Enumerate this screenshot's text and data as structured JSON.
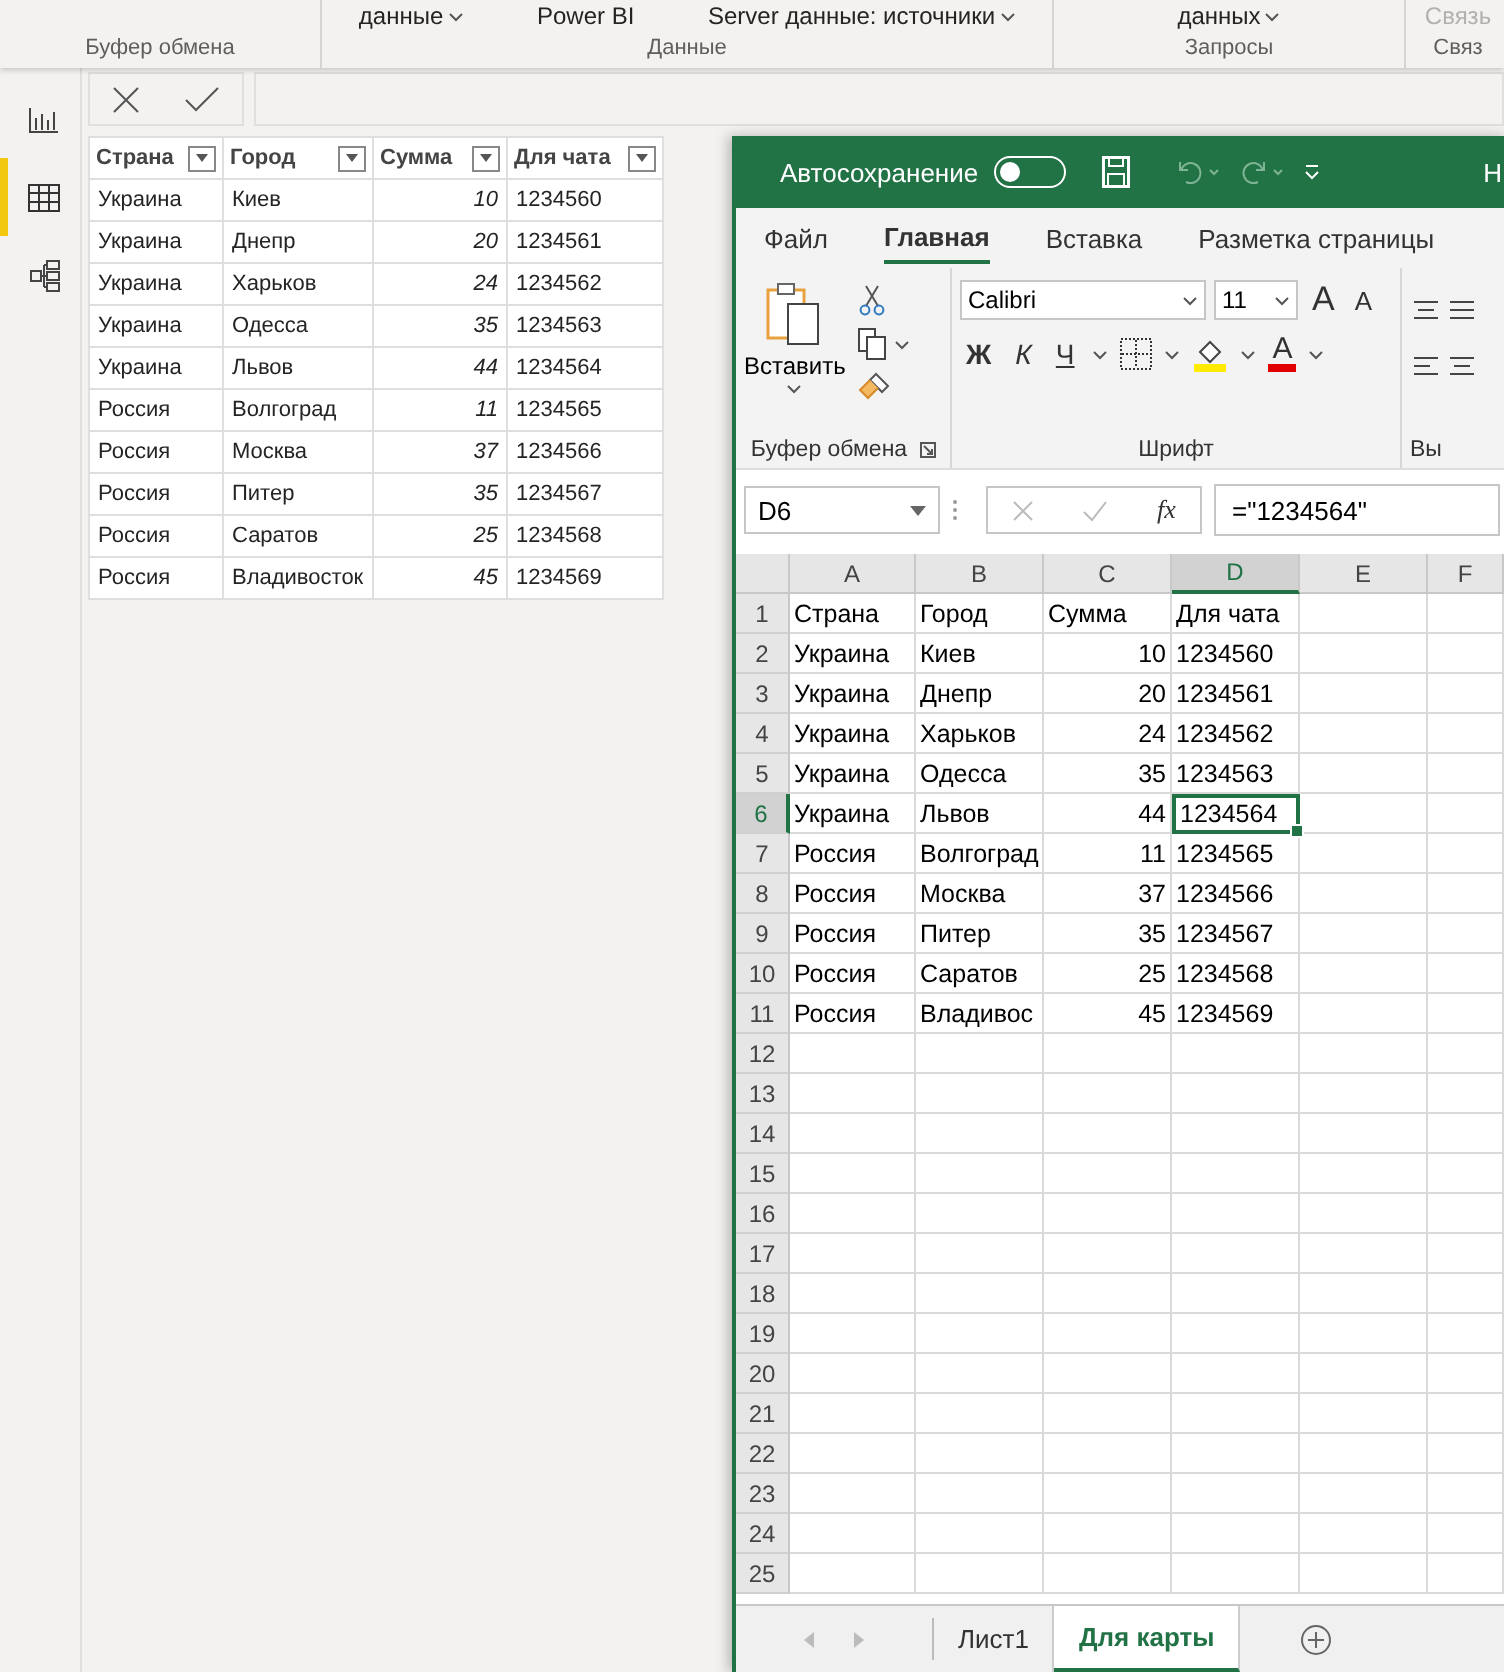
{
  "pbi": {
    "ribbon_groups": [
      {
        "label": "Буфер обмена"
      },
      {
        "label": "Данные",
        "commands": [
          {
            "label": "данные",
            "caret": true,
            "disabled": false
          },
          {
            "label": "Power BI",
            "caret": false,
            "disabled": false
          },
          {
            "label": "Server  данные: источники",
            "caret": true,
            "disabled": false
          }
        ]
      },
      {
        "label": "Запросы",
        "commands": [
          {
            "label": "данных",
            "caret": true,
            "disabled": false
          }
        ]
      },
      {
        "label": "Связ",
        "commands": [
          {
            "label": "Связь",
            "caret": false,
            "disabled": true
          }
        ]
      }
    ],
    "sidebar": {
      "items": [
        {
          "kind": "report",
          "selected": false
        },
        {
          "kind": "data",
          "selected": true
        },
        {
          "kind": "model",
          "selected": false
        }
      ]
    },
    "table": {
      "columns": [
        {
          "label": "Страна",
          "kind": "text"
        },
        {
          "label": "Город",
          "kind": "text"
        },
        {
          "label": "Сумма",
          "kind": "number"
        },
        {
          "label": "Для чата",
          "kind": "text"
        }
      ],
      "rows": [
        [
          "Украина",
          "Киев",
          "10",
          "1234560"
        ],
        [
          "Украина",
          "Днепр",
          "20",
          "1234561"
        ],
        [
          "Украина",
          "Харьков",
          "24",
          "1234562"
        ],
        [
          "Украина",
          "Одесса",
          "35",
          "1234563"
        ],
        [
          "Украина",
          "Львов",
          "44",
          "1234564"
        ],
        [
          "Россия",
          "Волгоград",
          "11",
          "1234565"
        ],
        [
          "Россия",
          "Москва",
          "37",
          "1234566"
        ],
        [
          "Россия",
          "Питер",
          "35",
          "1234567"
        ],
        [
          "Россия",
          "Саратов",
          "25",
          "1234568"
        ],
        [
          "Россия",
          "Владивосток",
          "45",
          "1234569"
        ]
      ]
    }
  },
  "excel": {
    "autosave": {
      "label": "Автосохранение",
      "on": false
    },
    "title": "Н",
    "tabs": [
      {
        "label": "Файл",
        "selected": false
      },
      {
        "label": "Главная",
        "selected": true
      },
      {
        "label": "Вставка",
        "selected": false
      },
      {
        "label": "Разметка страницы",
        "selected": false
      }
    ],
    "clipboard": {
      "paste_label": "Вставить",
      "group_label": "Буфер обмена"
    },
    "font": {
      "name": "Calibri",
      "size": "11",
      "grow": "A",
      "shrink": "A",
      "bold": "Ж",
      "italic": "К",
      "underline": "Ч",
      "color_letter": "А",
      "group_label": "Шрифт"
    },
    "next_group_label": "Вы",
    "formula": {
      "name_box": "D6",
      "fx": "fx",
      "value": "=\"1234564\""
    },
    "sheet": {
      "columns": [
        {
          "label": "A",
          "selected": false
        },
        {
          "label": "B",
          "selected": false
        },
        {
          "label": "C",
          "selected": false
        },
        {
          "label": "D",
          "selected": true
        },
        {
          "label": "E",
          "selected": false
        },
        {
          "label": "F",
          "selected": false
        }
      ],
      "rows": [
        {
          "num": "1",
          "selected": false,
          "cells": [
            "Страна",
            "Город",
            "Сумма",
            "Для чата"
          ]
        },
        {
          "num": "2",
          "selected": false,
          "cells": [
            "Украина",
            "Киев",
            "10",
            "1234560"
          ]
        },
        {
          "num": "3",
          "selected": false,
          "cells": [
            "Украина",
            "Днепр",
            "20",
            "1234561"
          ]
        },
        {
          "num": "4",
          "selected": false,
          "cells": [
            "Украина",
            "Харьков",
            "24",
            "1234562"
          ]
        },
        {
          "num": "5",
          "selected": false,
          "cells": [
            "Украина",
            "Одесса",
            "35",
            "1234563"
          ]
        },
        {
          "num": "6",
          "selected": true,
          "cells": [
            "Украина",
            "Львов",
            "44",
            "1234564"
          ]
        },
        {
          "num": "7",
          "selected": false,
          "cells": [
            "Россия",
            "Волгоград",
            "11",
            "1234565"
          ]
        },
        {
          "num": "8",
          "selected": false,
          "cells": [
            "Россия",
            "Москва",
            "37",
            "1234566"
          ]
        },
        {
          "num": "9",
          "selected": false,
          "cells": [
            "Россия",
            "Питер",
            "35",
            "1234567"
          ]
        },
        {
          "num": "10",
          "selected": false,
          "cells": [
            "Россия",
            "Саратов",
            "25",
            "1234568"
          ]
        },
        {
          "num": "11",
          "selected": false,
          "cells": [
            "Россия",
            "Владивос",
            "45",
            "1234569"
          ]
        },
        {
          "num": "12",
          "selected": false,
          "cells": []
        },
        {
          "num": "13",
          "selected": false,
          "cells": []
        },
        {
          "num": "14",
          "selected": false,
          "cells": []
        },
        {
          "num": "15",
          "selected": false,
          "cells": []
        },
        {
          "num": "16",
          "selected": false,
          "cells": []
        },
        {
          "num": "17",
          "selected": false,
          "cells": []
        },
        {
          "num": "18",
          "selected": false,
          "cells": []
        },
        {
          "num": "19",
          "selected": false,
          "cells": []
        },
        {
          "num": "20",
          "selected": false,
          "cells": []
        },
        {
          "num": "21",
          "selected": false,
          "cells": []
        },
        {
          "num": "22",
          "selected": false,
          "cells": []
        },
        {
          "num": "23",
          "selected": false,
          "cells": []
        },
        {
          "num": "24",
          "selected": false,
          "cells": []
        },
        {
          "num": "25",
          "selected": false,
          "cells": []
        }
      ]
    },
    "sheet_tabs": [
      {
        "label": "Лист1",
        "selected": false
      },
      {
        "label": "Для карты",
        "selected": true
      }
    ]
  }
}
